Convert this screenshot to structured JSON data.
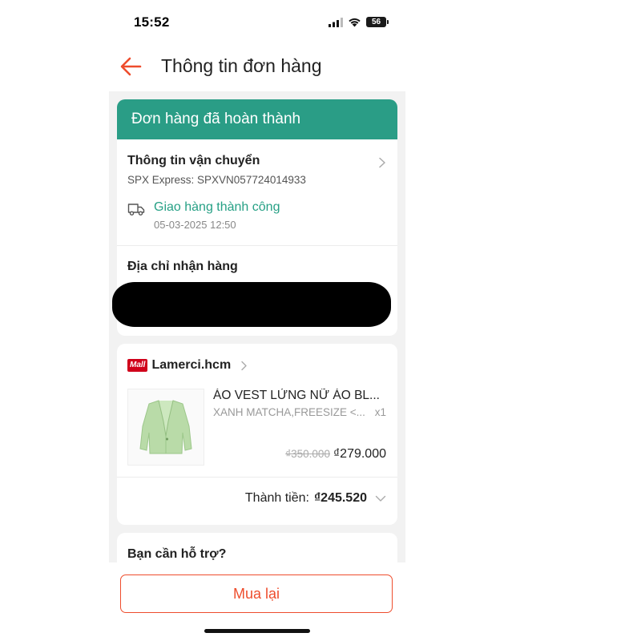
{
  "status_bar": {
    "time": "15:52",
    "battery": "56",
    "icons": [
      "cellular-signal-icon",
      "wifi-icon",
      "battery-icon"
    ]
  },
  "header": {
    "title": "Thông tin đơn hàng",
    "back_icon": "arrow-left-icon"
  },
  "order_status": {
    "banner": "Đơn hàng đã hoàn thành",
    "color": "#2a9d86"
  },
  "shipping": {
    "title": "Thông tin vận chuyển",
    "carrier_code": "SPX Express: SPXVN057724014933",
    "status": "Giao hàng thành công",
    "status_time": "05-03-2025 12:50"
  },
  "address": {
    "label": "Địa chỉ nhận hàng"
  },
  "shop": {
    "badge": "Mall",
    "name": "Lamerci.hcm",
    "product": {
      "name": "ÁO VEST LỬNG NỮ ÁO BL...",
      "variant": "XANH MATCHA,FREESIZE <...",
      "quantity": "x1",
      "original_price": "₫350.000",
      "sale_price": "₫279.000"
    },
    "total_label": "Thành tiền:",
    "total_value": "₫245.520"
  },
  "help": {
    "title": "Bạn cần hỗ trợ?"
  },
  "actions": {
    "rebuy_label": "Mua lại"
  },
  "colors": {
    "accent": "#ee4d2d",
    "success": "#26a085",
    "mall_badge": "#d0011b"
  }
}
